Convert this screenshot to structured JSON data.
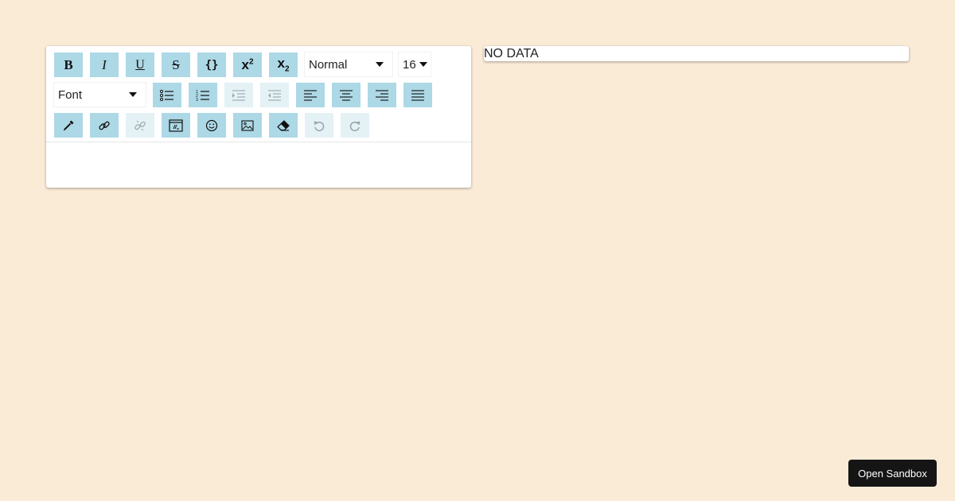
{
  "editor": {
    "block_type_select": {
      "value": "Normal"
    },
    "font_size_select": {
      "value": "16"
    },
    "font_family_select": {
      "value": "Font"
    }
  },
  "output": {
    "text": "NO DATA"
  },
  "sandbox_button": {
    "label": "Open Sandbox"
  },
  "colors": {
    "page_background": "#faebd7",
    "button_background": "#add8e6",
    "button_disabled_background": "#e4f1f5",
    "sandbox_button_background": "#151515"
  },
  "icons": {
    "bold": "bold-icon",
    "italic": "italic-icon",
    "underline": "underline-icon",
    "strikethrough": "strikethrough-icon",
    "code": "code-icon",
    "superscript": "superscript-icon",
    "subscript": "subscript-icon",
    "unordered_list": "unordered-list-icon",
    "ordered_list": "ordered-list-icon",
    "indent": "indent-icon",
    "outdent": "outdent-icon",
    "align_left": "align-left-icon",
    "align_center": "align-center-icon",
    "align_right": "align-right-icon",
    "align_justify": "align-justify-icon",
    "color_picker": "color-picker-icon",
    "link": "link-icon",
    "unlink": "unlink-icon",
    "embedded": "embedded-icon",
    "emoji": "emoji-icon",
    "image": "image-icon",
    "remove_format": "eraser-icon",
    "undo": "undo-icon",
    "redo": "redo-icon"
  },
  "states": {
    "indent_disabled": true,
    "outdent_disabled": true,
    "unlink_disabled": true,
    "undo_disabled": true,
    "redo_disabled": true
  }
}
